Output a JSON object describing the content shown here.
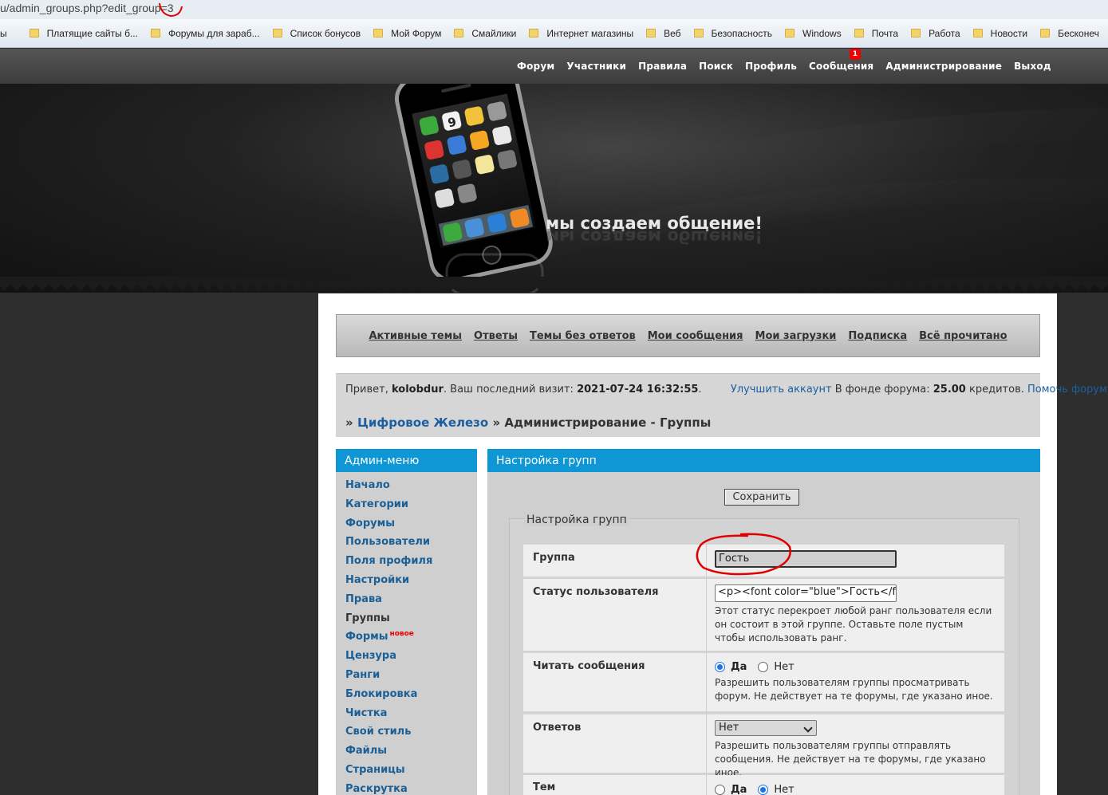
{
  "browser": {
    "url": "u/admin_groups.php?edit_group=3",
    "bookmarks": [
      "ы",
      "Платящие сайты б...",
      "Форумы для зараб...",
      "Список бонусов",
      "Мой Форум",
      "Смайлики",
      "Интернет магазины",
      "Веб",
      "Безопасность",
      "Windows",
      "Почта",
      "Работа",
      "Новости",
      "Бесконеч"
    ]
  },
  "topnav": {
    "items": [
      "Форум",
      "Участники",
      "Правила",
      "Поиск",
      "Профиль",
      "Сообщения",
      "Администрирование",
      "Выход"
    ],
    "messages_badge": "1"
  },
  "banner": {
    "slogan": "мы создаем общение!",
    "phone_date": "9"
  },
  "subnav": {
    "items": [
      "Активные темы",
      "Ответы",
      "Темы без ответов",
      "Мои сообщения",
      "Мои загрузки",
      "Подписка",
      "Всё прочитано"
    ]
  },
  "info": {
    "hello": "Привет,",
    "username": "kolobdur",
    "last_visit_label": ". Ваш последний визит:",
    "last_visit": "2021-07-24 16:32:55",
    "upgrade_link": "Улучшить аккаунт",
    "fund_label": "В фонде форума:",
    "fund_amount": "25.00",
    "credits_label": "кредитов.",
    "help_link": "Помочь форуму."
  },
  "breadcrumb": {
    "sep": "»",
    "forum": "Цифровое Железо",
    "current": "Администрирование - Группы"
  },
  "admin_menu": {
    "title": "Админ-меню",
    "items": [
      "Начало",
      "Категории",
      "Форумы",
      "Пользователи",
      "Поля профиля",
      "Настройки",
      "Права",
      "Группы",
      "Формы",
      "Цензура",
      "Ранги",
      "Блокировка",
      "Чистка",
      "Свой стиль",
      "Файлы",
      "Страницы",
      "Раскрутка"
    ],
    "new_tag": "новое"
  },
  "group_settings": {
    "title": "Настройка групп",
    "save_button": "Сохранить",
    "legend": "Настройка групп",
    "group_label": "Группа",
    "group_value": "Гость",
    "status_label": "Статус пользователя",
    "status_value": "<p><font color=\"blue\">Гость</fo",
    "status_desc": "Этот статус перекроет любой ранг пользователя если он состоит в этой группе. Оставьте поле пустым чтобы использовать ранг.",
    "read_label": "Читать сообщения",
    "yes": "Да",
    "no": "Нет",
    "read_desc": "Разрешить пользователям группы просматривать форум. Не действует на те форумы, где указано иное.",
    "reply_label": "Ответов",
    "reply_value": "Нет",
    "reply_desc": "Разрешить пользователям группы отправлять сообщения. Не действует на те форумы, где указано иное.",
    "topics_label": "Тем"
  },
  "colors": {
    "accent": "#0e97d4",
    "link": "#1a5f96",
    "annotation": "#e00000"
  }
}
